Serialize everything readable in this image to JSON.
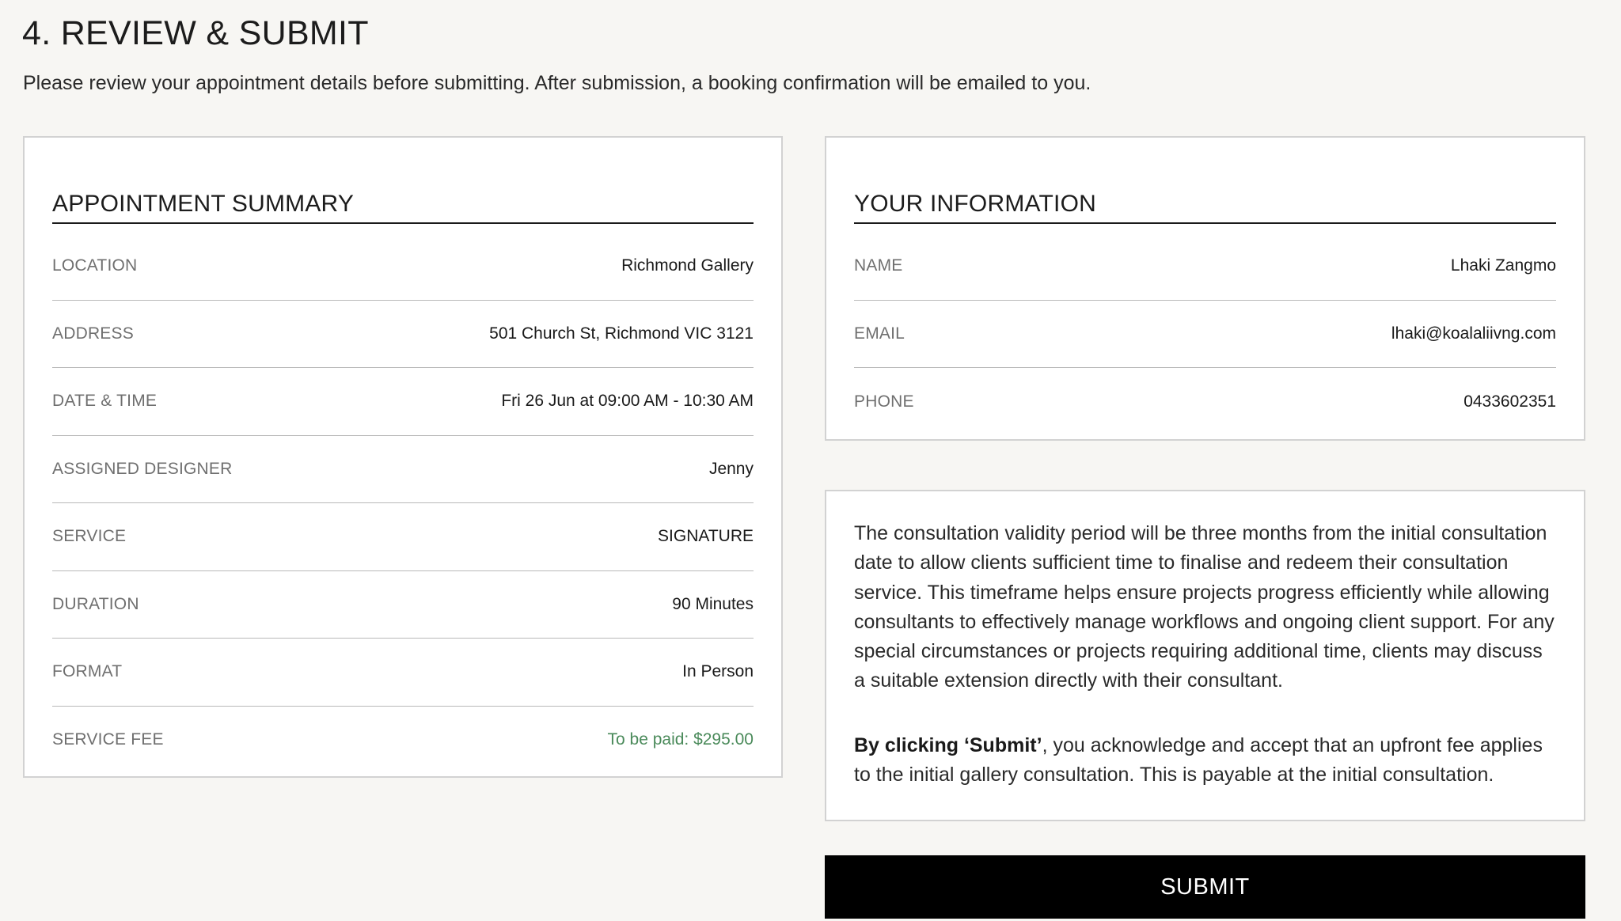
{
  "page": {
    "title": "4. REVIEW & SUBMIT",
    "intro": "Please review your appointment details before submitting. After submission, a booking confirmation will be emailed to you."
  },
  "summary": {
    "heading": "APPOINTMENT SUMMARY",
    "rows": [
      {
        "label": "LOCATION",
        "value": "Richmond Gallery"
      },
      {
        "label": "ADDRESS",
        "value": "501 Church St, Richmond VIC 3121"
      },
      {
        "label": "DATE & TIME",
        "value": "Fri 26 Jun at 09:00 AM - 10:30 AM"
      },
      {
        "label": "ASSIGNED DESIGNER",
        "value": "Jenny"
      },
      {
        "label": "SERVICE",
        "value": "SIGNATURE"
      },
      {
        "label": "DURATION",
        "value": "90 Minutes"
      },
      {
        "label": "FORMAT",
        "value": "In Person"
      },
      {
        "label": "SERVICE FEE",
        "value": "To be paid: $295.00"
      }
    ]
  },
  "info": {
    "heading": "YOUR INFORMATION",
    "rows": [
      {
        "label": "NAME",
        "value": "Lhaki Zangmo"
      },
      {
        "label": "EMAIL",
        "value": "lhaki@koalaliivng.com"
      },
      {
        "label": "PHONE",
        "value": "0433602351"
      }
    ]
  },
  "note": {
    "paragraph1": "The consultation validity period will be three months from the initial consultation date to allow clients sufficient time to finalise and redeem their consultation service. This timeframe helps ensure projects progress efficiently while allowing consultants to effectively manage workflows and ongoing client support. For any special circumstances or projects requiring additional time, clients may discuss a suitable extension directly with their consultant.",
    "ack_bold": "By clicking ‘Submit’",
    "ack_rest": ", you acknowledge and accept that an upfront fee applies to the initial gallery consultation. This is payable at the initial consultation."
  },
  "submit": {
    "label": "SUBMIT"
  },
  "colors": {
    "background": "#f7f6f3",
    "fee_text": "#4a8a5a",
    "button": "#000000"
  }
}
